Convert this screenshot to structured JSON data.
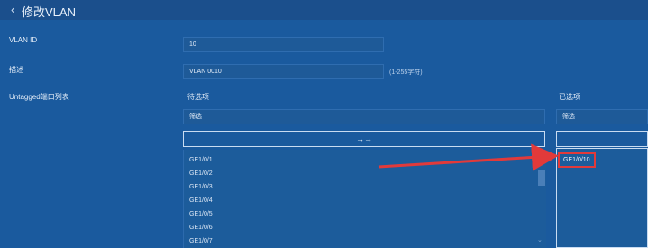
{
  "header": {
    "back_symbol": "‹",
    "title": "修改VLAN"
  },
  "form": {
    "vlan_id_label": "VLAN ID",
    "vlan_id_value": "10",
    "desc_label": "描述",
    "desc_value": "VLAN 0010",
    "desc_hint": "(1-255字符)",
    "untagged_label": "Untagged端口列表"
  },
  "candidates": {
    "title": "待选项",
    "filter_placeholder": "筛选",
    "move_button": "→→",
    "items": [
      "GE1/0/1",
      "GE1/0/2",
      "GE1/0/3",
      "GE1/0/4",
      "GE1/0/5",
      "GE1/0/6",
      "GE1/0/7"
    ]
  },
  "selected": {
    "title": "已选项",
    "filter_placeholder": "筛选",
    "items": [
      "GE1/0/10"
    ]
  },
  "colors": {
    "annotation": "#e23a3a",
    "background": "#1a5a9e"
  },
  "icons": {
    "back": "chevron-left-icon",
    "move": "double-arrow-right-icon"
  }
}
